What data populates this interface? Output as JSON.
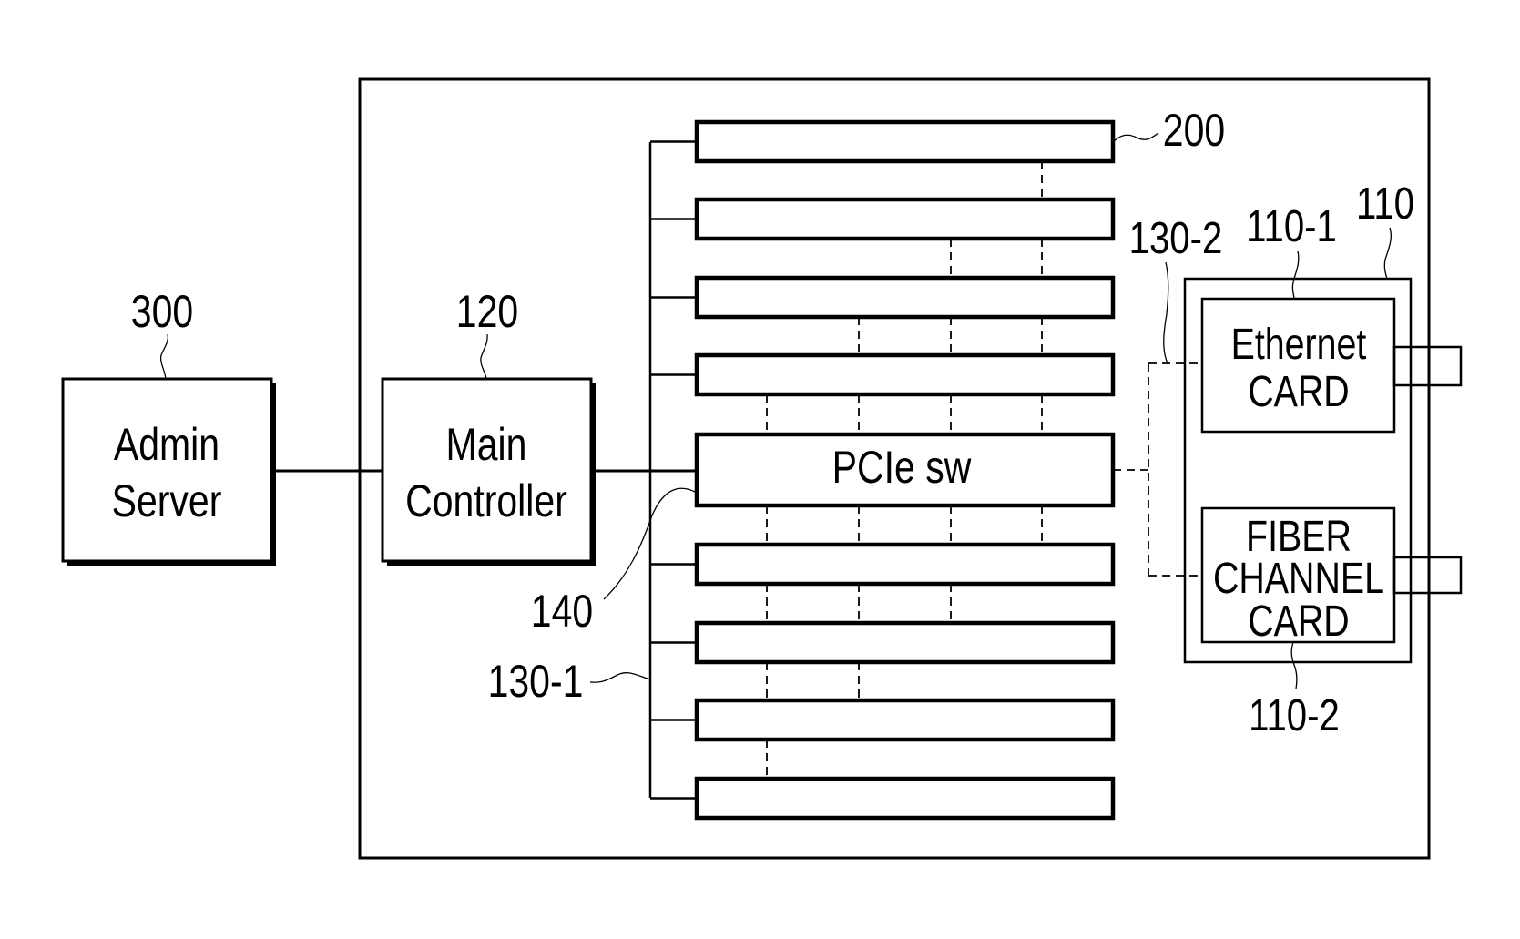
{
  "diagram": {
    "colors": {
      "stroke": "#000000",
      "background": "#ffffff"
    },
    "admin_server": {
      "ref": "300",
      "line1": "Admin",
      "line2": "Server"
    },
    "main_controller": {
      "ref": "120",
      "line1": "Main",
      "line2": "Controller"
    },
    "pcie_switch": {
      "ref": "140",
      "label": "PCIe sw"
    },
    "slots": {
      "ref": "200",
      "count": 8
    },
    "internal_bus": {
      "ref": "130-1"
    },
    "external_bus": {
      "ref": "130-2"
    },
    "interface_module": {
      "ref": "110",
      "ethernet_card": {
        "ref": "110-1",
        "line1": "Ethernet",
        "line2": "CARD"
      },
      "fiber_card": {
        "ref": "110-2",
        "line1": "FIBER",
        "line2": "CHANNEL",
        "line3": "CARD"
      }
    },
    "dashed_links": [
      {
        "between": "slot1-slot2",
        "columns": [
          4
        ]
      },
      {
        "between": "slot2-slot3",
        "columns": [
          3,
          4
        ]
      },
      {
        "between": "slot3-slot4",
        "columns": [
          2,
          3,
          4
        ]
      },
      {
        "between": "slot4-pcie",
        "columns": [
          1,
          2,
          3,
          4
        ]
      },
      {
        "between": "pcie-slot6",
        "columns": [
          1,
          2,
          3,
          4
        ]
      },
      {
        "between": "slot6-slot7",
        "columns": [
          1,
          2,
          3
        ]
      },
      {
        "between": "slot7-slot8",
        "columns": [
          1,
          2
        ]
      },
      {
        "between": "slot8-slot9",
        "columns": [
          1
        ]
      }
    ]
  }
}
